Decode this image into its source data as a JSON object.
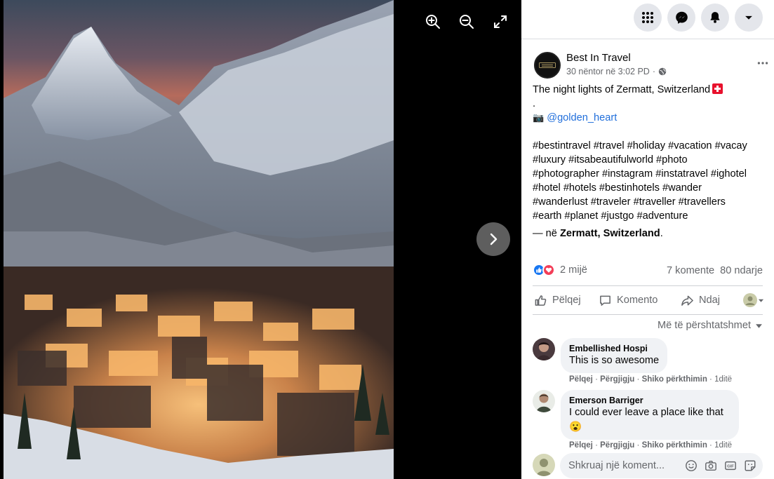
{
  "viewer": {
    "zoom_in_icon": "zoom-in-icon",
    "zoom_out_icon": "zoom-out-icon",
    "fullscreen_icon": "fullscreen-icon",
    "next_icon": "chevron-right-icon"
  },
  "topbar": {
    "icons": [
      "menu-grid-icon",
      "messenger-icon",
      "notifications-icon",
      "account-dropdown-icon"
    ]
  },
  "post": {
    "page_name": "Best In Travel",
    "timestamp": "30 nëntor në 3:02 PD",
    "caption_line1": "The night lights of Zermatt, Switzerland",
    "caption_dot": ".",
    "camera_emoji": "📷",
    "credit_link": "@golden_heart",
    "hashtags": [
      "#bestintravel #travel #holiday #vacation #vacay",
      "#luxury #itsabeautifulworld #photo",
      "#photographer #instagram #instatravel #ighotel",
      "#hotel #hotels #bestinhotels #wander",
      "#wanderlust #traveler #traveller #travellers",
      "#earth #planet #justgo #adventure"
    ],
    "location_prefix": "— në",
    "location": "Zermatt, Switzerland",
    "location_suffix": "."
  },
  "stats": {
    "reactions_count": "2 mijë",
    "comments": "7 komente",
    "shares": "80 ndarje"
  },
  "actions": {
    "like": "Pëlqej",
    "comment": "Komento",
    "share": "Ndaj"
  },
  "sort_label": "Më të përshtatshmet",
  "comments": [
    {
      "author": "Embellished Hospi",
      "text": "This is so awesome",
      "links": {
        "like": "Pëlqej",
        "reply": "Përgjigju",
        "translate": "Shiko përkthimin",
        "time": "1ditë"
      }
    },
    {
      "author": "Emerson Barriger",
      "text": "I could ever leave a place like that",
      "emoji": "😮",
      "links": {
        "like": "Pëlqej",
        "reply": "Përgjigju",
        "translate": "Shiko përkthimin",
        "time": "1ditë"
      }
    }
  ],
  "composer": {
    "placeholder": "Shkruaj një koment..."
  },
  "colors": {
    "link": "#216fdb",
    "muted": "#65676b",
    "bubble": "#f0f2f5",
    "like_blue": "#1877f2",
    "love_red": "#f33e58"
  }
}
